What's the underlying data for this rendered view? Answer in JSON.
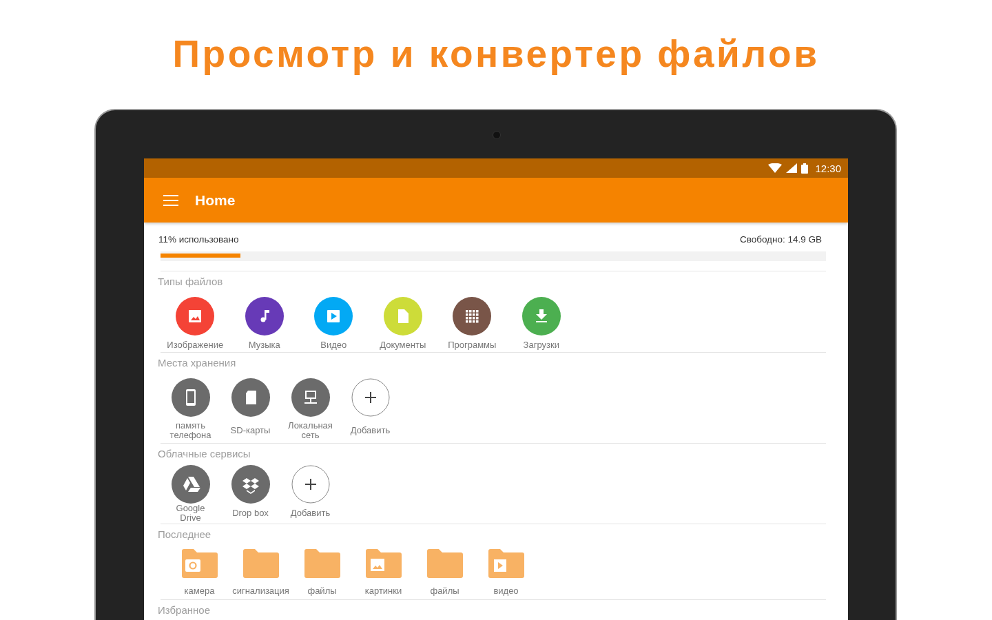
{
  "headline": "Просмотр и конвертер файлов",
  "status_bar": {
    "time": "12:30"
  },
  "app_bar": {
    "title": "Home"
  },
  "storage": {
    "used": "11% использовано",
    "free": "Свободно:  14.9 GB",
    "level": 0.12
  },
  "sections": [
    {
      "title": "Типы файлов",
      "kind": "types",
      "items": [
        {
          "label": "Изображение",
          "kind": "image",
          "color": "#f44336"
        },
        {
          "label": "Музыка",
          "kind": "music",
          "color": "#673ab7"
        },
        {
          "label": "Видео",
          "kind": "video",
          "color": "#03a9f4"
        },
        {
          "label": "Документы",
          "kind": "document",
          "color": "#cddc39"
        },
        {
          "label": "Программы",
          "kind": "apps",
          "color": "#795548"
        },
        {
          "label": "Загрузки",
          "kind": "download",
          "color": "#4caf50"
        }
      ]
    },
    {
      "title": "Места хранения",
      "kind": "storage",
      "items": [
        {
          "label": "память телефона",
          "kind": "phone"
        },
        {
          "label": "SD-карты",
          "kind": "sd"
        },
        {
          "label": "Локальная сеть",
          "kind": "network"
        },
        {
          "label": "Добавить",
          "kind": "add"
        }
      ]
    },
    {
      "title": "Облачные сервисы",
      "kind": "cloud",
      "items": [
        {
          "label": "Google Drive",
          "kind": "drive"
        },
        {
          "label": "Drop box",
          "kind": "dropbox"
        },
        {
          "label": "Добавить",
          "kind": "add"
        }
      ]
    },
    {
      "title": "Последнее",
      "kind": "folders",
      "items": [
        {
          "label": "камера",
          "kind": "camera"
        },
        {
          "label": "сигнализация",
          "kind": "plain"
        },
        {
          "label": "файлы",
          "kind": "plain"
        },
        {
          "label": "картинки",
          "kind": "image"
        },
        {
          "label": "файлы",
          "kind": "plain"
        },
        {
          "label": "видео",
          "kind": "video"
        }
      ]
    },
    {
      "title": "Избранное",
      "kind": "empty"
    }
  ]
}
